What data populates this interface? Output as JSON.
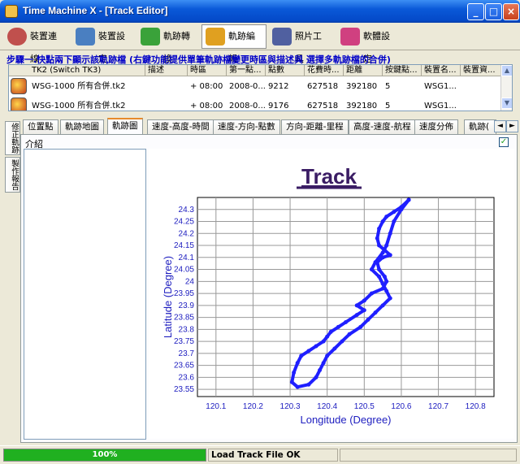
{
  "window": {
    "title": "Time Machine X - [Track Editor]",
    "controls": {
      "minimize": "_",
      "maximize": "□",
      "close": "×"
    }
  },
  "toolbar": {
    "items": [
      {
        "label": "裝置連線",
        "icon": "device-connect-icon",
        "color": "#c0504d"
      },
      {
        "label": "裝置設定",
        "icon": "device-settings-icon",
        "color": "#4a7fc1"
      },
      {
        "label": "軌跡轉換",
        "icon": "track-convert-icon",
        "color": "#3aa23a"
      },
      {
        "label": "軌跡編輯",
        "icon": "track-edit-icon",
        "color": "#e0a020",
        "active": true
      },
      {
        "label": "照片工具",
        "icon": "photo-tools-icon",
        "color": "#5060a0"
      },
      {
        "label": "軟體設定",
        "icon": "software-settings-icon",
        "color": "#d04080"
      }
    ]
  },
  "step_header": "步驟一.快點兩下顯示該軌跡檔 (右鍵功能提供單筆軌跡檔變更時區與描述與 選擇多軌跡檔的合併)",
  "track_table": {
    "columns": [
      "TK2 (Switch TK3)",
      "描述",
      "時區",
      "第一點...",
      "點數",
      "花費時...",
      "距離",
      "按鍵點...",
      "裝置名...",
      "裝置資..."
    ],
    "rows": [
      [
        "WSG-1000 所有合併.tk2",
        "",
        "+ 08:00",
        "2008-0...",
        "9212",
        "627518",
        "392180",
        "5",
        "WSG1...",
        ""
      ],
      [
        "WSG-1000 所有合併.tk2",
        "",
        "+ 08:00",
        "2008-0...",
        "9176",
        "627518",
        "392180",
        "5",
        "WSG1...",
        ""
      ]
    ]
  },
  "tabs": [
    {
      "label": "位置點"
    },
    {
      "label": "軌跡地圖"
    },
    {
      "label": "軌跡圖",
      "active": true
    },
    {
      "label": "速度-高度-時間"
    },
    {
      "label": "速度-方向-點數"
    },
    {
      "label": "方向-距離-里程"
    },
    {
      "label": "高度-速度-航程"
    },
    {
      "label": "速度分佈"
    },
    {
      "label": "軌跡("
    }
  ],
  "tab_nav": {
    "prev": "◄",
    "next": "►"
  },
  "side_tabs": [
    {
      "label": "修正軌跡"
    },
    {
      "label": "製作報告"
    }
  ],
  "intro_label": "介紹",
  "checkbox_checked": "✓",
  "chart_data": {
    "type": "line",
    "title": "Track",
    "xlabel": "Longitude (Degree)",
    "ylabel": "Latitude (Degree)",
    "xlim": [
      120.05,
      120.85
    ],
    "ylim": [
      23.52,
      24.35
    ],
    "xticks": [
      120.1,
      120.2,
      120.3,
      120.4,
      120.5,
      120.6,
      120.7,
      120.8
    ],
    "yticks": [
      23.55,
      23.6,
      23.65,
      23.7,
      23.75,
      23.8,
      23.85,
      23.9,
      23.95,
      24.0,
      24.05,
      24.1,
      24.15,
      24.2,
      24.25,
      24.3
    ],
    "ytick_labels": [
      "23.55",
      "23.6",
      "23.65",
      "23.7",
      "23.75",
      "23.8",
      "23.85",
      "23.9",
      "23.95",
      "24",
      "24.05",
      "24.1",
      "24.15",
      "24.2",
      "24.25",
      "24.3"
    ],
    "grid": true,
    "line_color": "#1f1fff",
    "series": [
      {
        "values_xy": [
          [
            120.62,
            24.34
          ],
          [
            120.6,
            24.31
          ],
          [
            120.58,
            24.29
          ],
          [
            120.56,
            24.27
          ],
          [
            120.55,
            24.25
          ],
          [
            120.54,
            24.22
          ],
          [
            120.535,
            24.18
          ],
          [
            120.54,
            24.15
          ],
          [
            120.555,
            24.13
          ],
          [
            120.57,
            24.11
          ],
          [
            120.55,
            24.1
          ],
          [
            120.535,
            24.08
          ],
          [
            120.54,
            24.05
          ],
          [
            120.555,
            24.02
          ],
          [
            120.56,
            24.0
          ],
          [
            120.55,
            23.97
          ],
          [
            120.52,
            23.95
          ],
          [
            120.5,
            23.92
          ],
          [
            120.48,
            23.9
          ],
          [
            120.5,
            23.88
          ],
          [
            120.48,
            23.86
          ],
          [
            120.45,
            23.83
          ],
          [
            120.43,
            23.81
          ],
          [
            120.41,
            23.79
          ],
          [
            120.4,
            23.77
          ],
          [
            120.39,
            23.75
          ],
          [
            120.37,
            23.73
          ],
          [
            120.35,
            23.71
          ],
          [
            120.33,
            23.69
          ],
          [
            120.32,
            23.66
          ],
          [
            120.31,
            23.62
          ],
          [
            120.305,
            23.58
          ],
          [
            120.32,
            23.56
          ],
          [
            120.35,
            23.57
          ],
          [
            120.37,
            23.6
          ],
          [
            120.38,
            23.63
          ],
          [
            120.39,
            23.66
          ],
          [
            120.4,
            23.69
          ],
          [
            120.42,
            23.72
          ],
          [
            120.44,
            23.75
          ],
          [
            120.46,
            23.78
          ],
          [
            120.49,
            23.81
          ],
          [
            120.51,
            23.84
          ],
          [
            120.53,
            23.87
          ],
          [
            120.55,
            23.9
          ],
          [
            120.57,
            23.93
          ],
          [
            120.56,
            23.96
          ],
          [
            120.55,
            23.99
          ],
          [
            120.54,
            24.02
          ],
          [
            120.52,
            24.05
          ],
          [
            120.53,
            24.08
          ],
          [
            120.55,
            24.12
          ],
          [
            120.56,
            24.15
          ],
          [
            120.57,
            24.2
          ],
          [
            120.58,
            24.25
          ],
          [
            120.6,
            24.3
          ],
          [
            120.62,
            24.34
          ]
        ]
      }
    ]
  },
  "status": {
    "progress_percent": 100,
    "progress_label": "100%",
    "message": "Load Track File OK"
  }
}
